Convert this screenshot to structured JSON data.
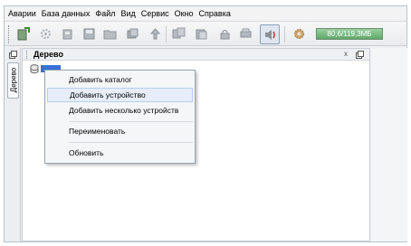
{
  "menubar": {
    "items": [
      "Аварии",
      "База данных",
      "Файл",
      "Вид",
      "Сервис",
      "Окно",
      "Справка"
    ]
  },
  "toolbar": {
    "memory_label": "80,6/119,3МБ",
    "buttons": [
      "new-icon",
      "settings-icon",
      "device-icon",
      "save-icon",
      "folder-icon",
      "database-icon",
      "upload-icon",
      "copy-icon",
      "paste-icon",
      "lock-icon",
      "print-icon",
      "sound-icon",
      "gear-icon"
    ]
  },
  "side": {
    "tab_label": "Дерево"
  },
  "panel": {
    "title": "Дерево",
    "close_glyph": "x"
  },
  "context_menu": {
    "items": [
      "Добавить каталог",
      "Добавить устройство",
      "Добавить несколько устройств",
      "Переименовать",
      "Обновить"
    ],
    "hovered": "Добавить устройство"
  },
  "colors": {
    "selection": "#3a6fd8",
    "hover": "#e7eefa",
    "memory_bar": "#5ea86a"
  }
}
